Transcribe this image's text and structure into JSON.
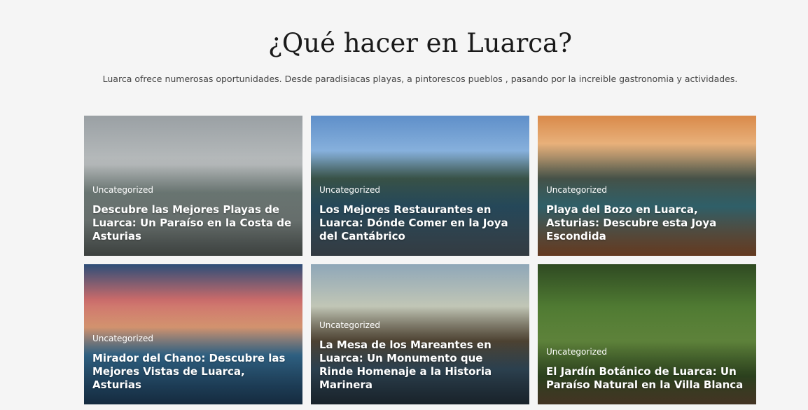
{
  "section": {
    "title": "¿Qué hacer en Luarca?",
    "subtitle": "Luarca ofrece numerosas oportunidades. Desde paradisiacas playas, a pintorescos pueblos , pasando por la increible gastronomia y actividades."
  },
  "cards": [
    {
      "category": "Uncategorized",
      "title": "Descubre las Mejores Playas de Luarca: Un Paraíso en la Costa de Asturias"
    },
    {
      "category": "Uncategorized",
      "title": "Los Mejores Restaurantes en Luarca: Dónde Comer en la Joya del Cantábrico"
    },
    {
      "category": "Uncategorized",
      "title": "Playa del Bozo en Luarca, Asturias: Descubre esta Joya Escondida"
    },
    {
      "category": "Uncategorized",
      "title": "Mirador del Chano: Descubre las Mejores Vistas de Luarca, Asturias"
    },
    {
      "category": "Uncategorized",
      "title": "La Mesa de los Mareantes en Luarca: Un Monumento que Rinde Homenaje a la Historia Marinera"
    },
    {
      "category": "Uncategorized",
      "title": "El Jardín Botánico de Luarca: Un Paraíso Natural en la Villa Blanca"
    }
  ]
}
